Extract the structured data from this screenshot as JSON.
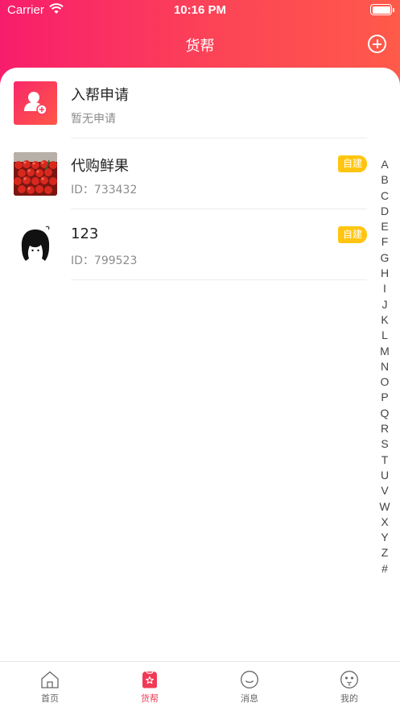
{
  "status": {
    "carrier": "Carrier",
    "time": "10:16 PM"
  },
  "nav": {
    "title": "货帮"
  },
  "colors": {
    "brand_gradient_start": "#f81d6c",
    "brand_gradient_end": "#ff5a4a",
    "badge": "#ffc510",
    "active_tab": "#f03a55"
  },
  "apply_row": {
    "title": "入帮申请",
    "subtitle": "暂无申请",
    "icon": "user-add-icon"
  },
  "groups": [
    {
      "name": "代购鲜果",
      "id_text": "ID：733432",
      "badge": "自建",
      "avatar": "fruit-photo"
    },
    {
      "name": "123",
      "id_text": "ID：799523",
      "badge": "自建",
      "avatar": "girl-sketch"
    }
  ],
  "index_letters": [
    "A",
    "B",
    "C",
    "D",
    "E",
    "F",
    "G",
    "H",
    "I",
    "J",
    "K",
    "L",
    "M",
    "N",
    "O",
    "P",
    "Q",
    "R",
    "S",
    "T",
    "U",
    "V",
    "W",
    "X",
    "Y",
    "Z",
    "#"
  ],
  "tabs": [
    {
      "label": "首页",
      "icon": "home-icon",
      "active": false
    },
    {
      "label": "货帮",
      "icon": "star-bag-icon",
      "active": true
    },
    {
      "label": "消息",
      "icon": "message-smile-icon",
      "active": false
    },
    {
      "label": "我的",
      "icon": "profile-face-icon",
      "active": false
    }
  ]
}
